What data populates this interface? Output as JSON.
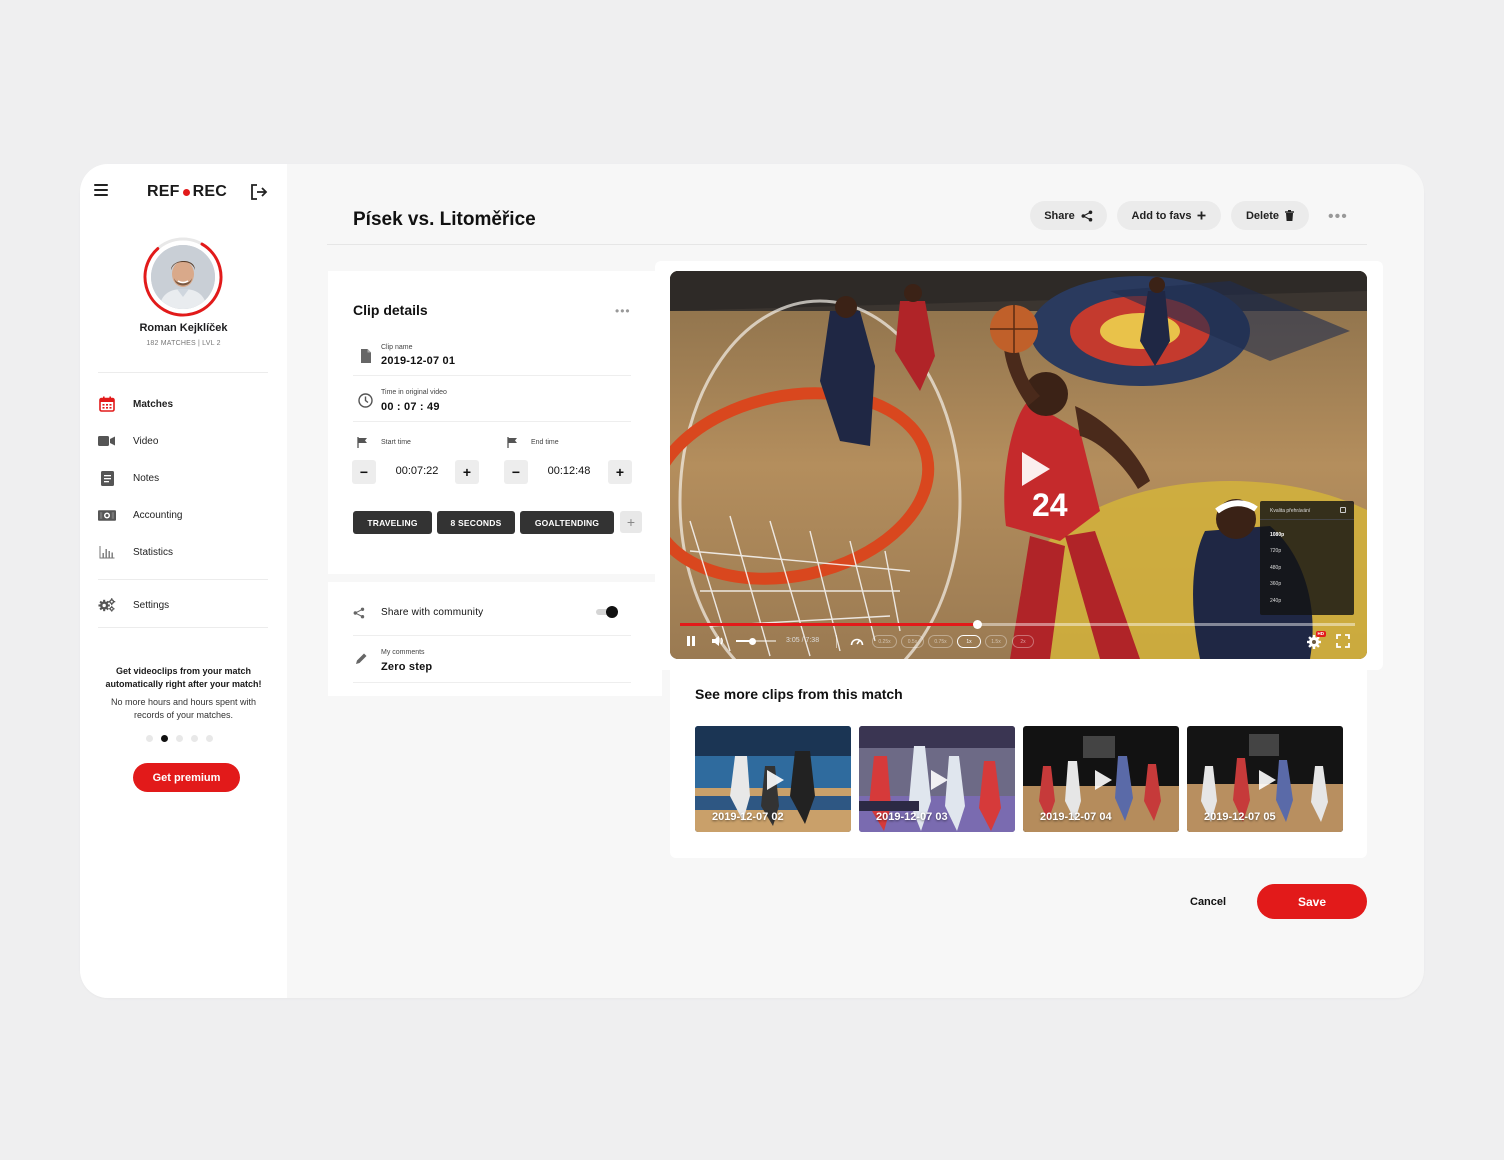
{
  "sidebar": {
    "logo_left": "REF",
    "logo_right": "REC",
    "user": {
      "name": "Roman Kejklíček",
      "meta": "182 MATCHES | LVL 2",
      "level_progress": 0.8
    },
    "nav": [
      {
        "label": "Matches",
        "icon": "calendar-icon",
        "active": true
      },
      {
        "label": "Video",
        "icon": "video-camera-icon"
      },
      {
        "label": "Notes",
        "icon": "notes-icon"
      },
      {
        "label": "Accounting",
        "icon": "money-icon"
      },
      {
        "label": "Statistics",
        "icon": "bar-chart-icon"
      },
      {
        "label": "Settings",
        "icon": "gears-icon"
      }
    ],
    "promo": {
      "title": "Get videoclips from your match automatically right after your match!",
      "text": "No more hours and hours spent with records of your matches.",
      "active_dot": 2,
      "dots_total": 5,
      "button": "Get premium"
    }
  },
  "header": {
    "title": "Písek vs. Litoměřice",
    "share": "Share",
    "add_to_favs": "Add to favs",
    "delete": "Delete"
  },
  "clip_details": {
    "title": "Clip details",
    "clip_name_label": "Clip name",
    "clip_name": "2019-12-07 01",
    "time_label": "Time in original video",
    "time": "00 : 07 : 49",
    "start_label": "Start time",
    "start": "00:07:22",
    "end_label": "End time",
    "end": "00:12:48",
    "tags": [
      "TRAVELING",
      "8 SECONDS",
      "GOALTENDING"
    ],
    "share_label": "Share with community",
    "share_enabled": true,
    "comments_label": "My comments",
    "comments": "Zero step"
  },
  "player": {
    "time": "3:05 / 7:38",
    "progress": 0.44,
    "volume": 0.4,
    "speeds": [
      "0.25x",
      "0.5x",
      "0.75x",
      "1x",
      "1.5x",
      "2x"
    ],
    "selected_speed": "1x",
    "hd_badge": "HD",
    "quality_title": "Kvalita přehrávání",
    "qualities": [
      "1080p",
      "720p",
      "480p",
      "360p",
      "240p"
    ],
    "selected_quality": "1080p",
    "jersey_number": "24"
  },
  "more_clips": {
    "title": "See more clips from this match",
    "clips": [
      "2019-12-07 02",
      "2019-12-07 03",
      "2019-12-07 04",
      "2019-12-07 05"
    ]
  },
  "actions": {
    "cancel": "Cancel",
    "save": "Save"
  },
  "colors": {
    "accent": "#e21a1a",
    "dark": "#333333",
    "background": "#f7f7f7"
  }
}
